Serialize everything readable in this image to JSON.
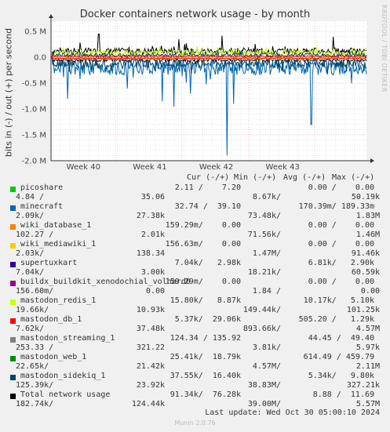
{
  "title": "Docker containers network usage - by month",
  "side_text": "RRDTOOL / TOBI OETIKER",
  "footer": "Munin 2.0.76",
  "last_update": "Last update: Wed Oct 30 05:00:10 2024",
  "legend_header": {
    "cur": "Cur (-/+)",
    "min": "Min (-/+)",
    "avg": "Avg (-/+)",
    "max": "Max (-/+)"
  },
  "colors": {
    "background": "#f0f0f0",
    "plot": "#ffffff",
    "grid_major": "#e8b0b0",
    "grid_minor": "#d8d8d8",
    "zero_line": "#000000"
  },
  "chart_data": {
    "type": "line",
    "title": "Docker containers network usage - by month",
    "ylabel": "bits in (-) / out (+) per second",
    "yticks": [
      "0.5 M",
      "0.0",
      "-0.5 M",
      "-1.0 M",
      "-1.5 M",
      "-2.0 M"
    ],
    "ytick_values": [
      0.5,
      0.0,
      -0.5,
      -1.0,
      -1.5,
      -2.0
    ],
    "ylim": [
      -2.0,
      0.7
    ],
    "y_unit": "M",
    "xticks": [
      "Week 40",
      "Week 41",
      "Week 42",
      "Week 43"
    ],
    "xtick_positions_weeks": [
      0.5,
      1.5,
      2.5,
      3.5
    ],
    "xlim_weeks": [
      0,
      4.75
    ],
    "grid": true,
    "series_note": "time series rendered as traces; values in Mbit/s (out positive, in negative)",
    "traces": [
      {
        "name": "Total network usage",
        "color": "#000000",
        "out_level": 0.12,
        "out_amp": 0.06,
        "in_level": -0.05,
        "in_amp": 0.03,
        "spikes": [
          [
            2.58,
            0.42
          ],
          [
            0.72,
            0.45
          ],
          [
            1.92,
            0.35
          ],
          [
            4.25,
            0.4
          ]
        ]
      },
      {
        "name": "mastodon_redis_1",
        "color": "#ccff00",
        "out_level": 0.09,
        "out_amp": 0.05,
        "in_level": -0.03,
        "in_amp": 0.01,
        "spikes": []
      },
      {
        "name": "minecraft",
        "color": "#0066b3",
        "out_level": 0.0,
        "out_amp": 0.0,
        "in_level": -0.2,
        "in_amp": 0.14,
        "spikes": [
          [
            2.65,
            -1.9
          ],
          [
            1.85,
            -0.95
          ],
          [
            2.1,
            -0.7
          ],
          [
            3.92,
            -1.3
          ],
          [
            0.25,
            -0.8
          ],
          [
            2.75,
            -0.9
          ],
          [
            1.68,
            -0.85
          ],
          [
            1.15,
            -0.6
          ]
        ]
      },
      {
        "name": "mastodon_sidekiq_1",
        "color": "#004466",
        "out_level": 0.04,
        "out_amp": 0.04,
        "in_level": -0.12,
        "in_amp": 0.08,
        "spikes": []
      },
      {
        "name": "mastodon_db_1",
        "color": "#ff0000",
        "out_level": 0.02,
        "out_amp": 0.01,
        "in_level": -0.02,
        "in_amp": 0.01,
        "spikes": []
      }
    ],
    "legend": [
      {
        "name": "picoshare",
        "color": "#00cc00",
        "cur": "2.11 /    7.20",
        "min": "    0.00 /    0.00",
        "l2": "4.84 /",
        "l2b": "35.06",
        "l2c": "8.67k/",
        "l2d": "50.19k"
      },
      {
        "name": "minecraft",
        "color": "#0066b3",
        "cur": "32.74 /  39.10",
        "min": "  170.39m/ 189.33m",
        "l2": "2.09k/",
        "l2b": "27.38k",
        "l2c": "73.48k/",
        "l2d": "1.83M"
      },
      {
        "name": "wiki_database_1",
        "color": "#ff8000",
        "cur": "159.29m/    0.00",
        "min": "    0.00 /    0.00",
        "l2": "102.27 /",
        "l2b": "2.01k",
        "l2c": "71.56k/",
        "l2d": "1.46M"
      },
      {
        "name": "wiki_mediawiki_1",
        "color": "#ffcc00",
        "cur": "156.63m/    0.00",
        "min": "    0.00 /    0.00",
        "l2": "2.03k/",
        "l2b": "138.34",
        "l2c": "1.47M/",
        "l2d": "91.46k"
      },
      {
        "name": "supertuxkart",
        "color": "#330099",
        "cur": "7.04k/   2.98k",
        "min": "   6.81k/   2.90k",
        "l2": "7.04k/",
        "l2b": "3.00k",
        "l2c": "18.21k/",
        "l2d": "60.59k"
      },
      {
        "name": "buildx_buildkit_xenodochial_volhard0",
        "color": "#990099",
        "cur": "159.29m/    0.00",
        "min": "    0.00 /    0.00",
        "l2": "156.60m/",
        "l2b": "0.00",
        "l2c": "1.84 /",
        "l2d": "0.00"
      },
      {
        "name": "mastodon_redis_1",
        "color": "#ccff00",
        "cur": "15.80k/   8.87k",
        "min": "   10.17k/   5.10k",
        "l2": "19.66k/",
        "l2b": "10.93k",
        "l2c": "149.44k/",
        "l2d": "101.25k"
      },
      {
        "name": "mastodon_db_1",
        "color": "#ff0000",
        "cur": "5.37k/  29.06k",
        "min": "  505.20 /   1.29k",
        "l2": "7.62k/",
        "l2b": "37.48k",
        "l2c": "893.66k/",
        "l2d": "4.57M"
      },
      {
        "name": "mastodon_streaming_1",
        "color": "#808080",
        "cur": "124.34 / 135.92",
        "min": "   44.45 /  49.40",
        "l2": "253.33 /",
        "l2b": "321.22",
        "l2c": "3.81k/",
        "l2d": "5.97k"
      },
      {
        "name": "mastodon_web_1",
        "color": "#008f00",
        "cur": "25.41k/  18.79k",
        "min": "  614.49 / 459.79",
        "l2": "22.65k/",
        "l2b": "21.42k",
        "l2c": "4.57M/",
        "l2d": "2.11M"
      },
      {
        "name": "mastodon_sidekiq_1",
        "color": "#004466",
        "cur": "37.55k/  16.40k",
        "min": "   5.34k/   9.80k",
        "l2": "125.39k/",
        "l2b": "23.92k",
        "l2c": "38.83M/",
        "l2d": "327.21k"
      },
      {
        "name": "Total network usage",
        "color": "#000000",
        "cur": "91.34k/  76.28k",
        "min": "   8.88 /  11.69",
        "l2": "182.74k/",
        "l2b": "124.44k",
        "l2c": "39.00M/",
        "l2d": "5.57M"
      }
    ]
  }
}
